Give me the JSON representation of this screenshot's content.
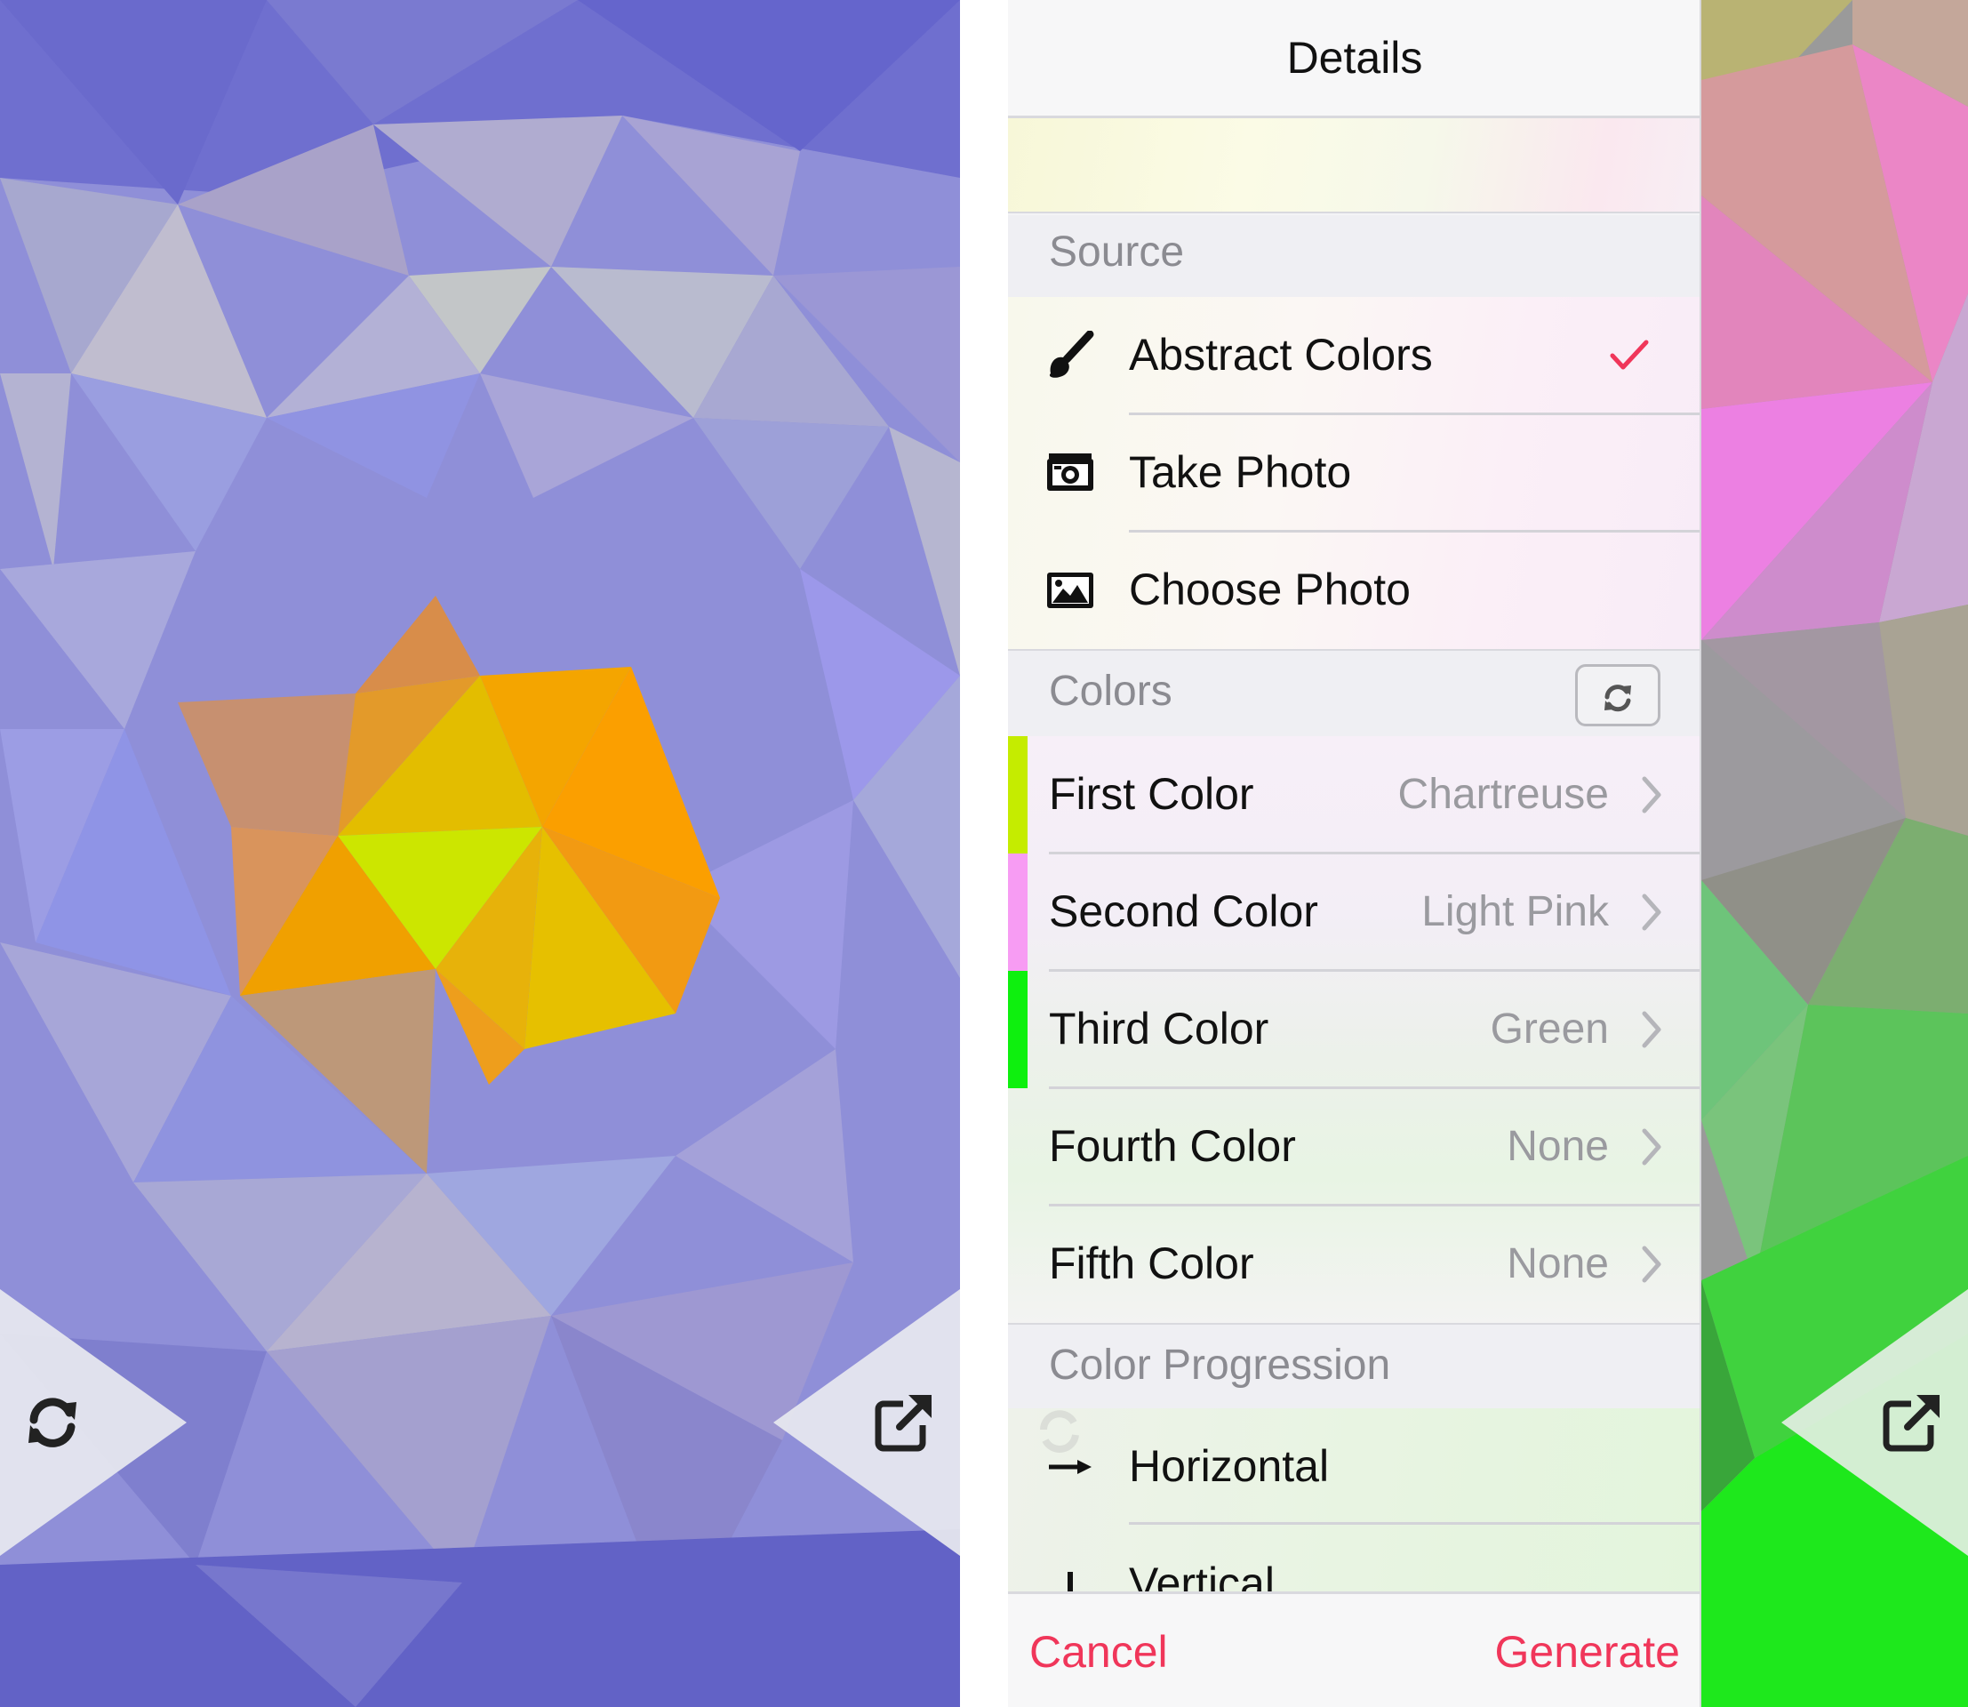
{
  "navbar": {
    "title": "Details"
  },
  "source_section": {
    "header": "Source",
    "items": [
      {
        "label": "Abstract Colors",
        "icon": "paintbrush-icon",
        "selected": true
      },
      {
        "label": "Take Photo",
        "icon": "camera-icon",
        "selected": false
      },
      {
        "label": "Choose Photo",
        "icon": "image-icon",
        "selected": false
      }
    ]
  },
  "colors_section": {
    "header": "Colors",
    "shuffle_icon": "shuffle-icon",
    "items": [
      {
        "label": "First Color",
        "value": "Chartreuse",
        "swatch": "#c5ec00"
      },
      {
        "label": "Second Color",
        "value": "Light Pink",
        "swatch": "#f79cf3"
      },
      {
        "label": "Third Color",
        "value": "Green",
        "swatch": "#0ef00e"
      },
      {
        "label": "Fourth Color",
        "value": "None",
        "swatch": ""
      },
      {
        "label": "Fifth Color",
        "value": "None",
        "swatch": ""
      }
    ]
  },
  "progression_section": {
    "header": "Color Progression",
    "items": [
      {
        "label": "Horizontal",
        "icon": "arrow-right-icon"
      },
      {
        "label": "Vertical",
        "icon": "vertical-bar-icon"
      }
    ]
  },
  "bottom_bar": {
    "cancel": "Cancel",
    "generate": "Generate"
  },
  "colors": {
    "accent": "#f0365a"
  },
  "left_screen": {
    "refresh_icon": "refresh-icon",
    "share_icon": "share-icon"
  },
  "right_screen": {
    "share_icon": "share-icon"
  }
}
